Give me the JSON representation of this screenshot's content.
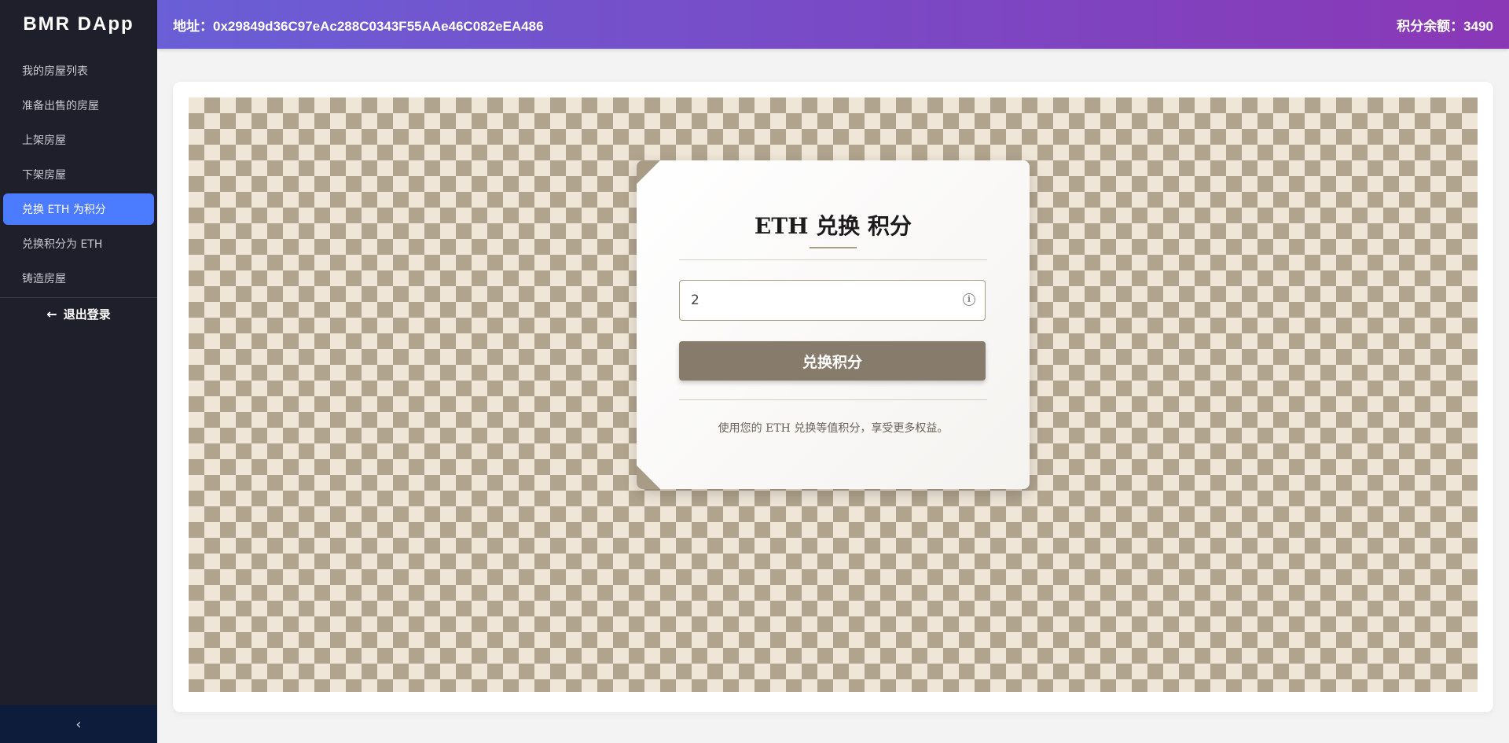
{
  "sidebar": {
    "brand": "BMR DApp",
    "items": [
      {
        "label": "我的房屋列表"
      },
      {
        "label": "准备出售的房屋"
      },
      {
        "label": "上架房屋"
      },
      {
        "label": "下架房屋"
      },
      {
        "label": "兑换 ETH 为积分",
        "active": true
      },
      {
        "label": "兑换积分为 ETH"
      },
      {
        "label": "铸造房屋"
      }
    ],
    "logout_label": "退出登录",
    "logout_icon": "arrow-left-icon",
    "collapse_icon": "chevron-left-icon"
  },
  "header": {
    "address": "地址：0x29849d36C97eAc288C0343F55AAe46C082eEA486",
    "balance": "积分余额：3490"
  },
  "exchange": {
    "title": "ETH 兑换 积分",
    "input_value": "2",
    "input_icon": "info-icon",
    "button_label": "兑换积分",
    "note": "使用您的 ETH 兑换等值积分，享受更多权益。"
  },
  "colors": {
    "sidebar_bg": "#1e1f2a",
    "active_item": "#4b7bff",
    "header_gradient_start": "#6a5fd6",
    "header_gradient_end": "#8a38b6",
    "button_bg": "#877b6b",
    "checker_dark": "#b0a48e",
    "checker_light": "#efe6d7"
  }
}
